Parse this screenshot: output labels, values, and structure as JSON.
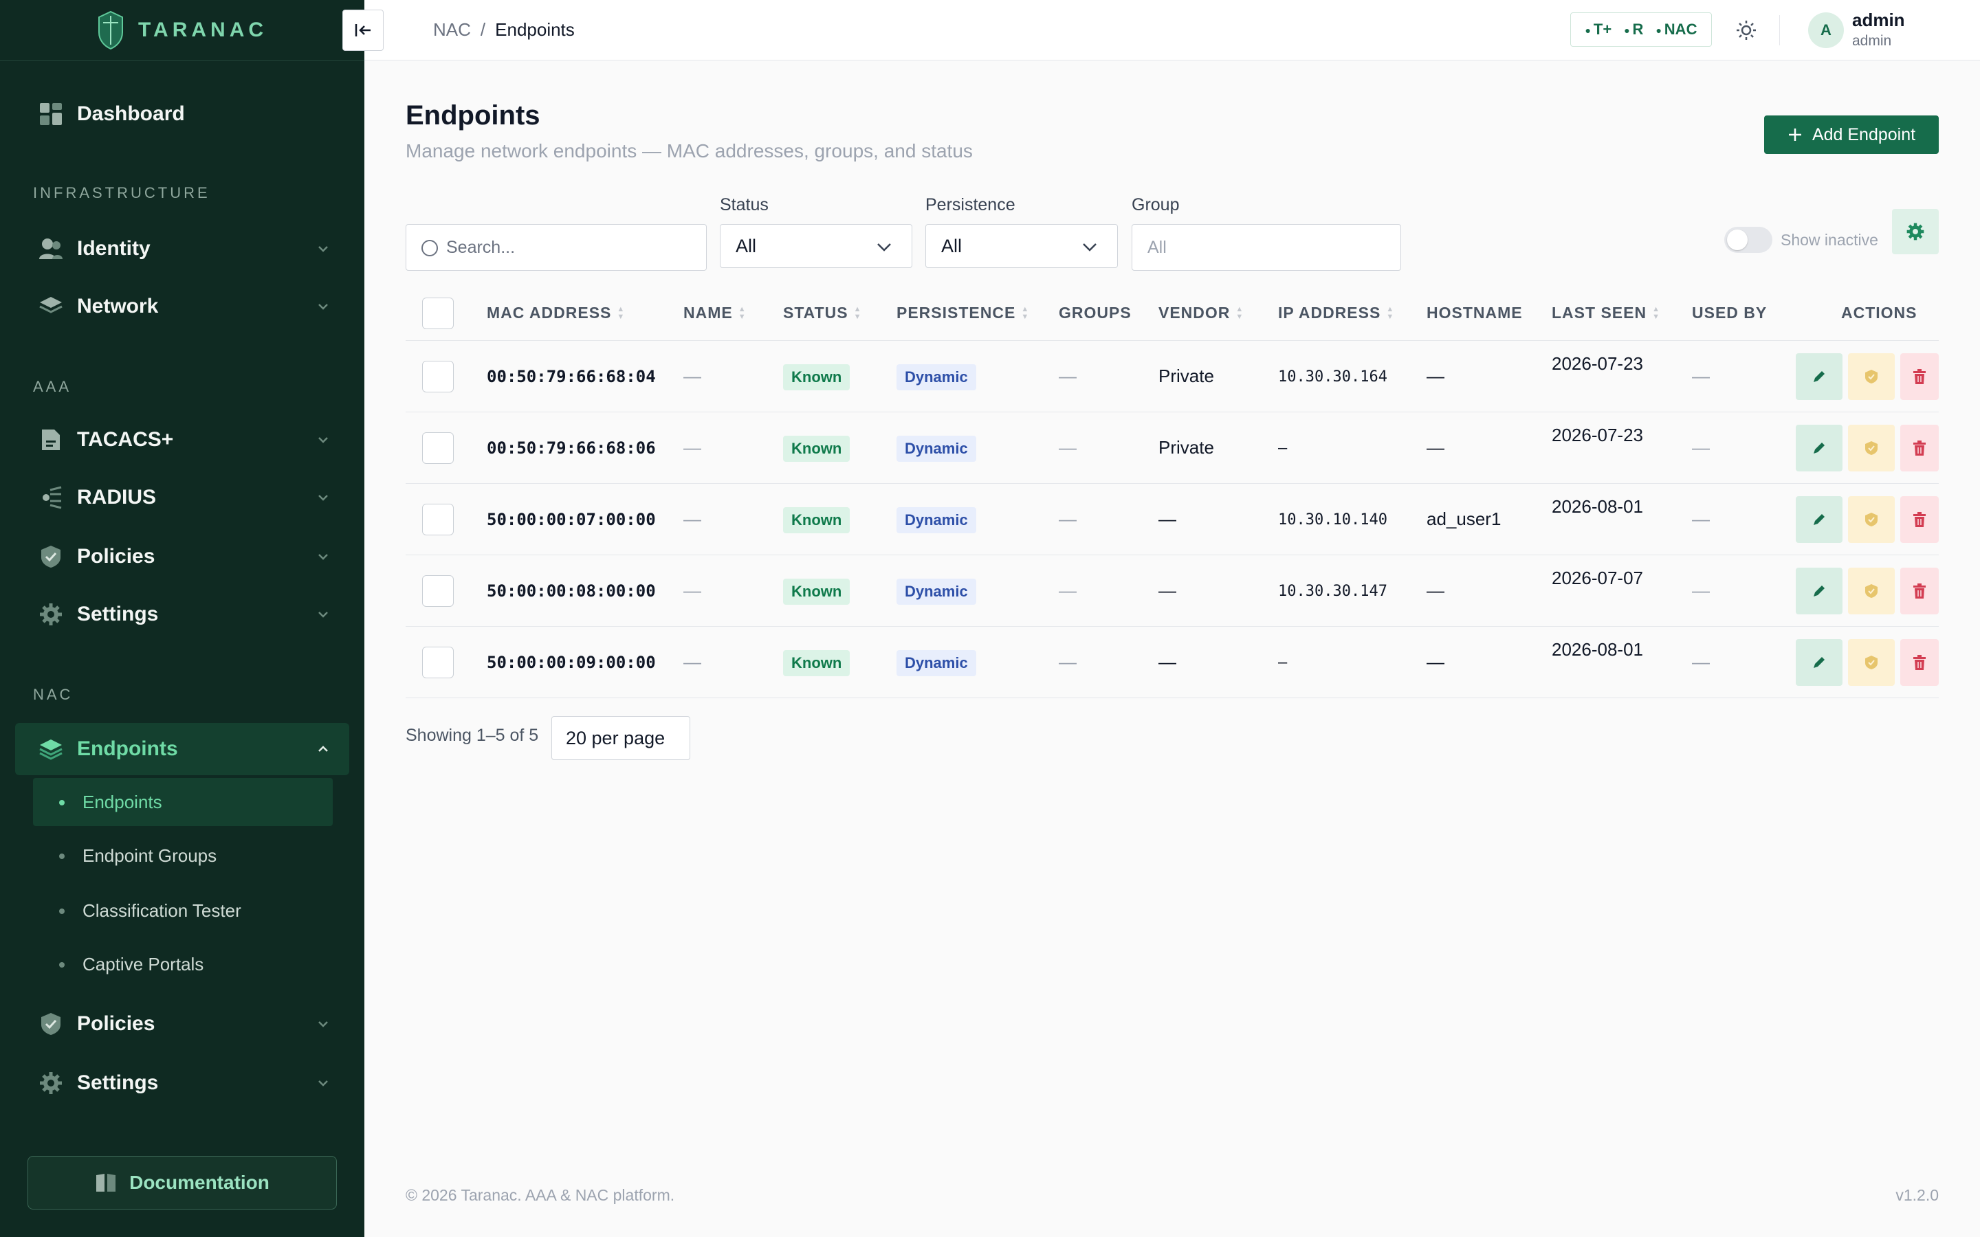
{
  "brand": {
    "name": "TARANAC"
  },
  "sidebar": {
    "dashboard": "Dashboard",
    "sections": {
      "infrastructure": "INFRASTRUCTURE",
      "aaa": "AAA",
      "nac": "NAC"
    },
    "infra_items": [
      "Identity",
      "Network"
    ],
    "aaa_items": [
      "TACACS+",
      "RADIUS",
      "Policies",
      "Settings"
    ],
    "nac_active": "Endpoints",
    "nac_sub": [
      "Endpoints",
      "Endpoint Groups",
      "Classification Tester",
      "Captive Portals"
    ],
    "nac_items": [
      "Policies",
      "Settings"
    ],
    "documentation": "Documentation"
  },
  "topbar": {
    "breadcrumb": [
      "NAC",
      "/",
      "Endpoints"
    ],
    "protocols": [
      "T+",
      "R",
      "NAC"
    ],
    "avatar_initial": "A",
    "user_name": "admin",
    "user_role": "admin"
  },
  "page": {
    "title": "Endpoints",
    "subtitle": "Manage network endpoints — MAC addresses, groups, and status",
    "add_button": "Add Endpoint"
  },
  "filters": {
    "search_placeholder": "Search...",
    "status_label": "Status",
    "status_value": "All",
    "persistence_label": "Persistence",
    "persistence_value": "All",
    "group_label": "Group",
    "group_placeholder": "All",
    "show_inactive": "Show inactive"
  },
  "table": {
    "headers": [
      "MAC ADDRESS",
      "NAME",
      "STATUS",
      "PERSISTENCE",
      "GROUPS",
      "VENDOR",
      "IP ADDRESS",
      "HOSTNAME",
      "LAST SEEN",
      "USED BY",
      "ACTIONS"
    ],
    "rows": [
      {
        "mac": "00:50:79:66:68:04",
        "name": "—",
        "status": "Known",
        "persistence": "Dynamic",
        "groups": "—",
        "vendor": "Private",
        "ip": "10.30.30.164",
        "hostname": "—",
        "last_seen": "2026-07-23",
        "used_by": "—"
      },
      {
        "mac": "00:50:79:66:68:06",
        "name": "—",
        "status": "Known",
        "persistence": "Dynamic",
        "groups": "—",
        "vendor": "Private",
        "ip": "–",
        "hostname": "—",
        "last_seen": "2026-07-23",
        "used_by": "—"
      },
      {
        "mac": "50:00:00:07:00:00",
        "name": "—",
        "status": "Known",
        "persistence": "Dynamic",
        "groups": "—",
        "vendor": "—",
        "ip": "10.30.10.140",
        "hostname": "ad_user1",
        "last_seen": "2026-08-01",
        "used_by": "—"
      },
      {
        "mac": "50:00:00:08:00:00",
        "name": "—",
        "status": "Known",
        "persistence": "Dynamic",
        "groups": "—",
        "vendor": "—",
        "ip": "10.30.30.147",
        "hostname": "—",
        "last_seen": "2026-07-07",
        "used_by": "—"
      },
      {
        "mac": "50:00:00:09:00:00",
        "name": "—",
        "status": "Known",
        "persistence": "Dynamic",
        "groups": "—",
        "vendor": "—",
        "ip": "–",
        "hostname": "—",
        "last_seen": "2026-08-01",
        "used_by": "—"
      }
    ]
  },
  "pagination": {
    "showing": "Showing 1–5 of 5",
    "per_page": "20 per page"
  },
  "footer": {
    "copyright": "© 2026 Taranac. AAA & NAC platform.",
    "version": "v1.2.0"
  },
  "colors": {
    "sidebar_bg": "#0f2a22",
    "accent": "#166c4b",
    "accent_light": "#6fdba6"
  },
  "icons": [
    "shield-logo-icon",
    "dashboard-icon",
    "users-icon",
    "layers-icon",
    "file-icon",
    "radius-icon",
    "shield-check-icon",
    "gear-icon",
    "chevron-down-icon",
    "chevron-up-icon",
    "book-icon",
    "collapse-left-icon",
    "sun-icon",
    "plus-icon",
    "search-icon",
    "pencil-icon",
    "tag-icon",
    "trash-icon"
  ]
}
